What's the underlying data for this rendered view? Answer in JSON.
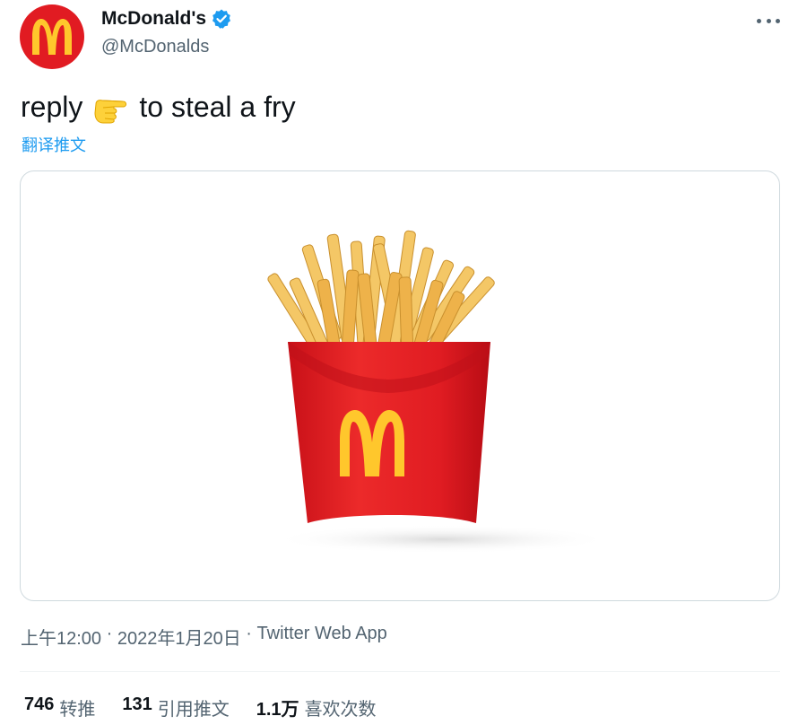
{
  "author": {
    "display_name": "McDonald's",
    "handle": "@McDonalds"
  },
  "tweet": {
    "text_before": "reply",
    "emoji_icon": "pointing-hand-emoji",
    "text_after": "to steal a fry",
    "translate_label": "翻译推文"
  },
  "meta": {
    "time": "上午12:00",
    "sep1": "·",
    "date": "2022年1月20日",
    "sep2": "·",
    "source": "Twitter Web App"
  },
  "stats": {
    "retweets_count": "746",
    "retweets_label": "转推",
    "quotes_count": "131",
    "quotes_label": "引用推文",
    "likes_count": "1.1万",
    "likes_label": "喜欢次数"
  },
  "colors": {
    "brand_red": "#e11b22",
    "arches_yellow": "#ffc72c",
    "link_blue": "#1d9bf0",
    "muted_text": "#536471"
  }
}
